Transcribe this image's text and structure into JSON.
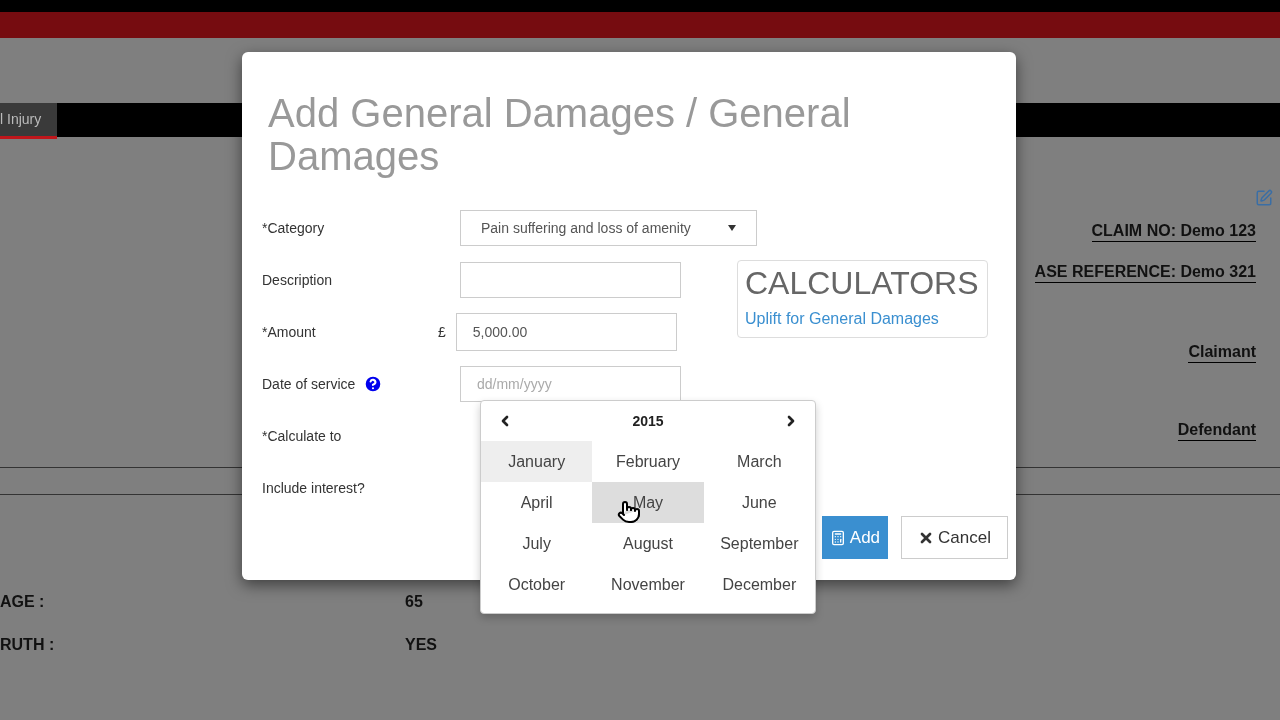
{
  "background": {
    "tab": "l Injury",
    "claim_no": "CLAIM NO: Demo 123",
    "case_reference": "ASE REFERENCE: Demo 321",
    "parties": [
      "Claimant",
      "Defendant"
    ],
    "details": [
      {
        "label": "AGE :",
        "value": "65"
      },
      {
        "label": "RUTH :",
        "value": "YES"
      }
    ]
  },
  "dialog": {
    "title": "Add General Damages / General Damages",
    "fields": [
      {
        "kind": "select",
        "label": "*Category",
        "value": "Pain suffering and loss of amenity"
      },
      {
        "kind": "text",
        "label": "Description"
      },
      {
        "kind": "amount",
        "label": "*Amount",
        "prefix": "£",
        "value": "5,000.00"
      },
      {
        "kind": "date",
        "label": "Date of service",
        "placeholder": "dd/mm/yyyy",
        "help": true
      },
      {
        "kind": "covered",
        "label": "*Calculate to"
      },
      {
        "kind": "covered",
        "label": "Include interest?"
      }
    ],
    "calculators": {
      "title": "CALCULATORS",
      "link": "Uplift for General Damages"
    },
    "buttons": [
      {
        "kind": "primary",
        "label": "Add"
      },
      {
        "kind": "cancel",
        "label": "Cancel"
      }
    ]
  },
  "datepicker": {
    "year": "2015",
    "months": [
      {
        "label": "January",
        "selected": true,
        "hovered": false
      },
      {
        "label": "February",
        "selected": false,
        "hovered": false
      },
      {
        "label": "March",
        "selected": false,
        "hovered": false
      },
      {
        "label": "April",
        "selected": false,
        "hovered": false
      },
      {
        "label": "May",
        "selected": false,
        "hovered": true
      },
      {
        "label": "June",
        "selected": false,
        "hovered": false
      },
      {
        "label": "July",
        "selected": false,
        "hovered": false
      },
      {
        "label": "August",
        "selected": false,
        "hovered": false
      },
      {
        "label": "September",
        "selected": false,
        "hovered": false
      },
      {
        "label": "October",
        "selected": false,
        "hovered": false
      },
      {
        "label": "November",
        "selected": false,
        "hovered": false
      },
      {
        "label": "December",
        "selected": false,
        "hovered": false
      }
    ]
  }
}
